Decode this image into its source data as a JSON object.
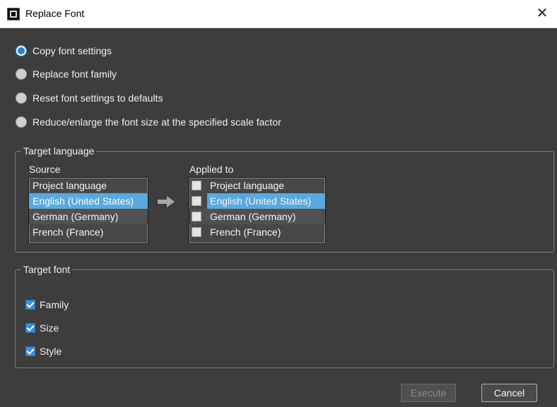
{
  "window": {
    "title": "Replace Font"
  },
  "modes": [
    {
      "label": "Copy font settings",
      "selected": true
    },
    {
      "label": "Replace font family",
      "selected": false
    },
    {
      "label": "Reset font settings to defaults",
      "selected": false
    },
    {
      "label": "Reduce/enlarge the font size at the specified scale factor",
      "selected": false
    }
  ],
  "target_language": {
    "legend": "Target language",
    "source_label": "Source",
    "applied_label": "Applied to",
    "source_items": [
      "Project language",
      "English (United States)",
      "German (Germany)",
      "French (France)"
    ],
    "source_selected": "English (United States)",
    "applied_items": [
      {
        "label": "Project language",
        "checked": false
      },
      {
        "label": "English (United States)",
        "checked": false
      },
      {
        "label": "German (Germany)",
        "checked": false
      },
      {
        "label": "French (France)",
        "checked": false
      }
    ],
    "applied_selected": "English (United States)",
    "arrow_icon": "arrow-right-icon"
  },
  "target_font": {
    "legend": "Target font",
    "options": [
      {
        "label": "Family",
        "checked": true
      },
      {
        "label": "Size",
        "checked": true
      },
      {
        "label": "Style",
        "checked": true
      }
    ]
  },
  "buttons": {
    "execute": "Execute",
    "cancel": "Cancel",
    "execute_enabled": false
  },
  "colors": {
    "background": "#3d3d3d",
    "selection": "#5aa8e0",
    "accent": "#3d8fd8"
  }
}
